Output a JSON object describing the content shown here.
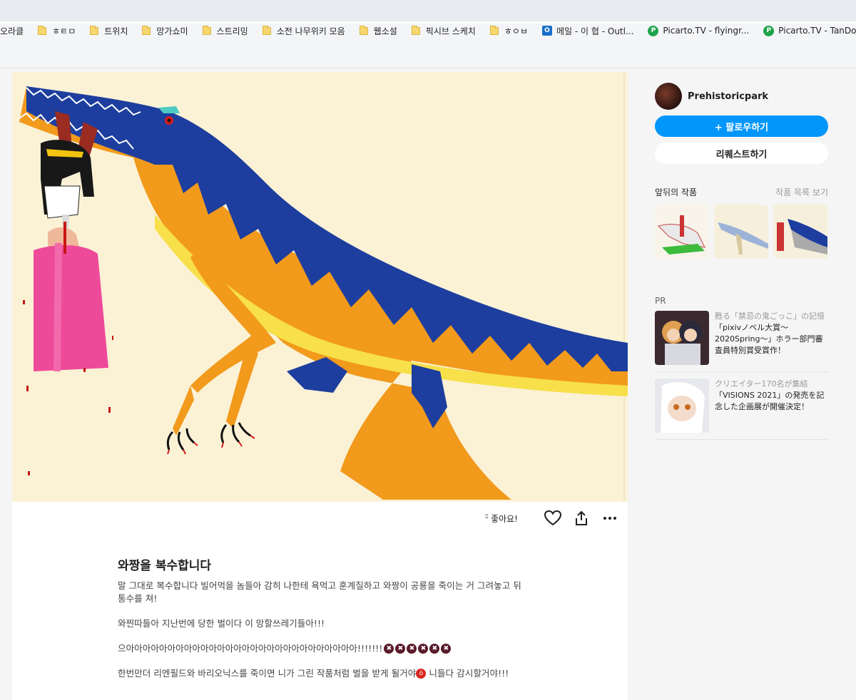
{
  "bookmarks": [
    {
      "label": "오라클",
      "icon": "none"
    },
    {
      "label": "ㅎㅌㅁ",
      "icon": "folder"
    },
    {
      "label": "트위치",
      "icon": "folder"
    },
    {
      "label": "망가쇼미",
      "icon": "folder"
    },
    {
      "label": "스트리밍",
      "icon": "folder"
    },
    {
      "label": "소전 나무위키 모음",
      "icon": "folder"
    },
    {
      "label": "웹소설",
      "icon": "folder"
    },
    {
      "label": "픽시브 스케치",
      "icon": "folder"
    },
    {
      "label": "ㅎㅇㅂ",
      "icon": "folder"
    },
    {
      "label": "메일 - 이 협 - Outl...",
      "icon": "outlook"
    },
    {
      "label": "Picarto.TV - flyingr...",
      "icon": "picarto"
    },
    {
      "label": "Picarto.TV - TanDo...",
      "icon": "picarto"
    }
  ],
  "actions": {
    "like_face": "ᵕ̈",
    "like_label": "좋아요!"
  },
  "post": {
    "title": "와짱을 복수합니다",
    "para1": "말 그대로 복수합니다 빌어먹을 놈들아 감히 나한테 욕먹고 훈계질하고 와짱이 공룡을 죽이는 거 그려놓고 뒤통수를 쳐!",
    "para2": "와찐따들아 지난번에 당한 벌이다 이 망할쓰레기들아!!!",
    "para3": "으아아아아아아아아아아아아아아아아아아아아아아아아아아아아!!!!!!!",
    "para4a": "한번만더 리엔필드와 바리오닉스를 죽이면 니가 그린 작품처럼 벌을 받게 될거야",
    "para4b": " 니들다 감시할거야!!!"
  },
  "sidebar": {
    "author_name": "Prehistoricpark",
    "follow_label": "+ 팔로우하기",
    "request_label": "리퀘스트하기",
    "nearby_title": "앞뒤의 작품",
    "nearby_link": "작품 목록 보기",
    "pr_label": "PR",
    "pr_items": [
      {
        "sub": "甦る「禁忌の鬼ごっこ」の記憶",
        "main": "「pixivノベル大賞～2020Spring～」ホラー部門審査員特別賞受賞作！"
      },
      {
        "sub": "クリエイター170名が集結",
        "main": "「VISIONS 2021」の発売を記念した企画展が開催決定！"
      }
    ]
  },
  "colors": {
    "accent": "#0096fa",
    "dino_blue": "#1d3e9e",
    "dino_orange": "#f29a1c",
    "paper": "#fbf2d6"
  }
}
